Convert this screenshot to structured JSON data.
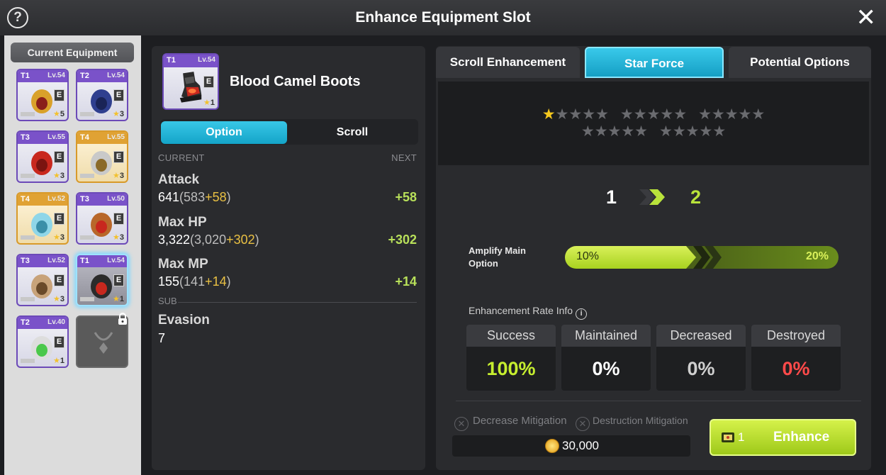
{
  "window": {
    "title": "Enhance Equipment Slot",
    "help_icon": "?",
    "close_icon": "✕"
  },
  "equipment": {
    "header": "Current Equipment",
    "slots": [
      {
        "tier": "T1",
        "level": "Lv.54",
        "stars": "5",
        "item": "helmet"
      },
      {
        "tier": "T2",
        "level": "Lv.54",
        "stars": "3",
        "item": "cape"
      },
      {
        "tier": "T3",
        "level": "Lv.55",
        "stars": "3",
        "item": "overall"
      },
      {
        "tier": "T4",
        "level": "Lv.55",
        "stars": "3",
        "item": "shoulder"
      },
      {
        "tier": "T4",
        "level": "Lv.52",
        "stars": "3",
        "item": "belt"
      },
      {
        "tier": "T3",
        "level": "Lv.50",
        "stars": "3",
        "item": "pendant"
      },
      {
        "tier": "T3",
        "level": "Lv.52",
        "stars": "3",
        "item": "gloves"
      },
      {
        "tier": "T1",
        "level": "Lv.54",
        "stars": "1",
        "item": "boots"
      },
      {
        "tier": "T2",
        "level": "Lv.40",
        "stars": "1",
        "item": "ring"
      },
      {
        "tier": "",
        "level": "",
        "stars": "",
        "item": "locked"
      }
    ],
    "e_badge": "E"
  },
  "selected_item": {
    "tier": "T1",
    "level": "Lv.54",
    "name": "Blood Camel Boots",
    "stars": "1",
    "e_badge": "E"
  },
  "detail_tabs": {
    "option": "Option",
    "scroll": "Scroll"
  },
  "stats": {
    "current_label": "CURRENT",
    "next_label": "NEXT",
    "sub_label": "SUB",
    "main": [
      {
        "name": "Attack",
        "total": "641",
        "base": "583",
        "bonus": "+58",
        "next": "+58"
      },
      {
        "name": "Max HP",
        "total": "3,322",
        "base": "3,020",
        "bonus": "+302",
        "next": "+302"
      },
      {
        "name": "Max MP",
        "total": "155",
        "base": "141",
        "bonus": "+14",
        "next": "+14"
      }
    ],
    "sub": [
      {
        "name": "Evasion",
        "total": "7"
      }
    ]
  },
  "enhance_tabs": {
    "scroll": "Scroll Enhancement",
    "star_force": "Star Force",
    "potential": "Potential Options"
  },
  "star_force": {
    "stars_filled": 1,
    "stars_total": 25,
    "from_level": "1",
    "to_level": "2",
    "amplify_label_line1": "Amplify Main",
    "amplify_label_line2": "Option",
    "amplify_current": "10%",
    "amplify_next": "20%",
    "amplify_fill_fraction": 0.48,
    "rate_title": "Enhancement Rate Info",
    "rates": [
      {
        "label": "Success",
        "value": "100%",
        "color": "#c6ee2f"
      },
      {
        "label": "Maintained",
        "value": "0%",
        "color": "#ffffff"
      },
      {
        "label": "Decreased",
        "value": "0%",
        "color": "#cfcfcf"
      },
      {
        "label": "Destroyed",
        "value": "0%",
        "color": "#ff4a4a"
      }
    ],
    "decrease_mitigation": "Decrease Mitigation",
    "destruction_mitigation": "Destruction Mitigation",
    "cost": "30,000",
    "enhance_qty": "1",
    "enhance_label": "Enhance"
  },
  "colors": {
    "accent_cyan": "#1fb4d9",
    "accent_green": "#b6dd2a",
    "star_gold": "#f5c81e"
  }
}
